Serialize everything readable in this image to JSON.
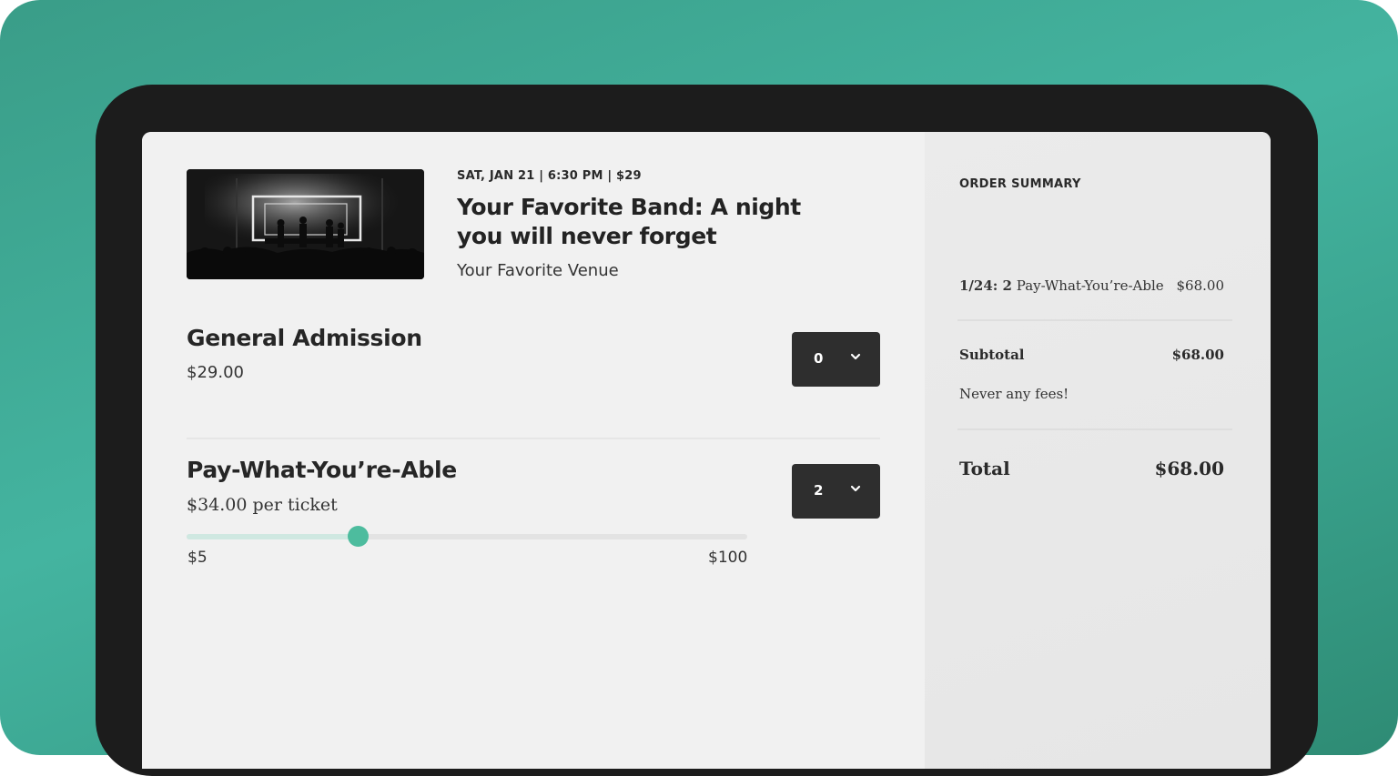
{
  "event": {
    "meta": "SAT, JAN 21 | 6:30 PM | $29",
    "title": "Your Favorite Band: A night you will never forget",
    "venue": "Your Favorite Venue",
    "image_icon": "concert-stage-photo"
  },
  "tickets": [
    {
      "name": "General Admission",
      "price": "$29.00",
      "quantity": "0"
    },
    {
      "name": "Pay-What-You’re-Able",
      "price": "$34.00 per ticket",
      "quantity": "2",
      "slider": {
        "min_label": "$5",
        "max_label": "$100",
        "min": 5,
        "max": 100,
        "value": 34
      }
    }
  ],
  "summary": {
    "title": "ORDER SUMMARY",
    "line_prefix": "1/24: 2",
    "line_label": "Pay-What-You’re-Able",
    "line_amount": "$68.00",
    "subtotal_label": "Subtotal",
    "subtotal_amount": "$68.00",
    "fees_note": "Never any fees!",
    "total_label": "Total",
    "total_amount": "$68.00"
  },
  "colors": {
    "accent": "#4dbc9e",
    "backdrop": "#44b4a0",
    "device": "#1c1c1c",
    "select_bg": "#2e2e2e"
  },
  "icons": {
    "close": "close-icon",
    "dropdown": "chevron-down-icon"
  }
}
